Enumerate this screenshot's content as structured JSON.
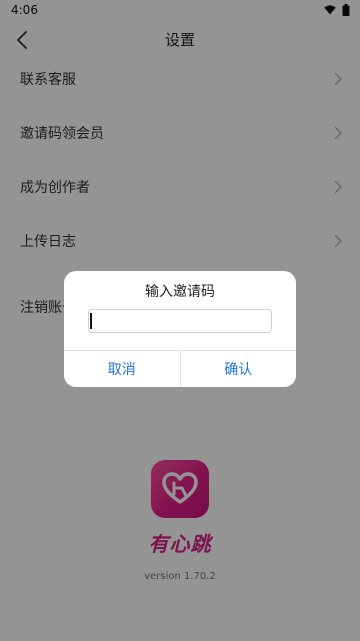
{
  "status_bar": {
    "time": "4:06",
    "icons": [
      "wifi-icon",
      "battery-icon"
    ]
  },
  "header": {
    "title": "设置",
    "back_icon": "chevron-left-icon"
  },
  "settings": {
    "items": [
      {
        "label": "联系客服"
      },
      {
        "label": "邀请码领会员"
      },
      {
        "label": "成为创作者"
      },
      {
        "label": "上传日志"
      },
      {
        "label": "注销账号"
      }
    ]
  },
  "brand": {
    "name": "有心跳",
    "version": "version  1.70.2",
    "accent": "#d81f86"
  },
  "dialog": {
    "title": "输入邀请码",
    "input_value": "",
    "cancel_label": "取消",
    "confirm_label": "确认",
    "button_color": "#1f75d9"
  }
}
